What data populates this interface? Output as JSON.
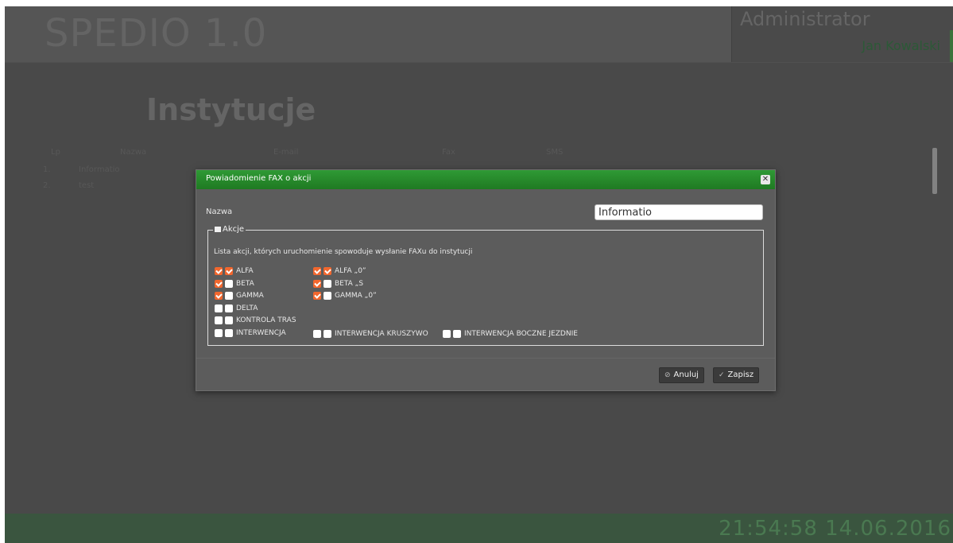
{
  "app": {
    "title": "SPEDIO 1.0",
    "role": "Administrator",
    "user": "Jan Kowalski",
    "clock": "21:54:58 14.06.2016"
  },
  "page": {
    "title": "Instytucje",
    "table": {
      "headers": [
        "Lp",
        "Nazwa",
        "E-mail",
        "Fax",
        "SMS"
      ],
      "rows": [
        {
          "lp": "1.",
          "name": "Informatio"
        },
        {
          "lp": "2.",
          "name": "test"
        }
      ]
    }
  },
  "dialog": {
    "title": "Powiadomienie FAX o akcji",
    "close_icon": "close-icon",
    "name_label": "Nazwa",
    "name_value": "Informatio",
    "actions_legend": "Akcje",
    "actions_description": "Lista akcji, których uruchomienie spowoduje wysłanie FAXu do instytucji",
    "actions_left": [
      {
        "label": "ALFA",
        "cb1": true,
        "cb2": true
      },
      {
        "label": "BETA",
        "cb1": true,
        "cb2": false
      },
      {
        "label": "GAMMA",
        "cb1": true,
        "cb2": false
      },
      {
        "label": "DELTA",
        "cb1": false,
        "cb2": false
      },
      {
        "label": "KONTROLA TRAS",
        "cb1": false,
        "cb2": false
      },
      {
        "label": "INTERWENCJA",
        "cb1": false,
        "cb2": false
      }
    ],
    "actions_right": [
      {
        "label": "ALFA „0”",
        "cb1": true,
        "cb2": true
      },
      {
        "label": "BETA „S",
        "cb1": true,
        "cb2": false
      },
      {
        "label": "GAMMA „0”",
        "cb1": true,
        "cb2": false
      }
    ],
    "actions_bottom": [
      {
        "label": "INTERWENCJA KRUSZYWO",
        "cb1": false,
        "cb2": false
      },
      {
        "label": "INTERWENCJA BOCZNE JEZDNIE",
        "cb1": false,
        "cb2": false
      }
    ],
    "cancel_label": "Anuluj",
    "save_label": "Zapisz"
  },
  "colors": {
    "accent": "#1f7a22",
    "checkbox_on": "#f2672e"
  }
}
